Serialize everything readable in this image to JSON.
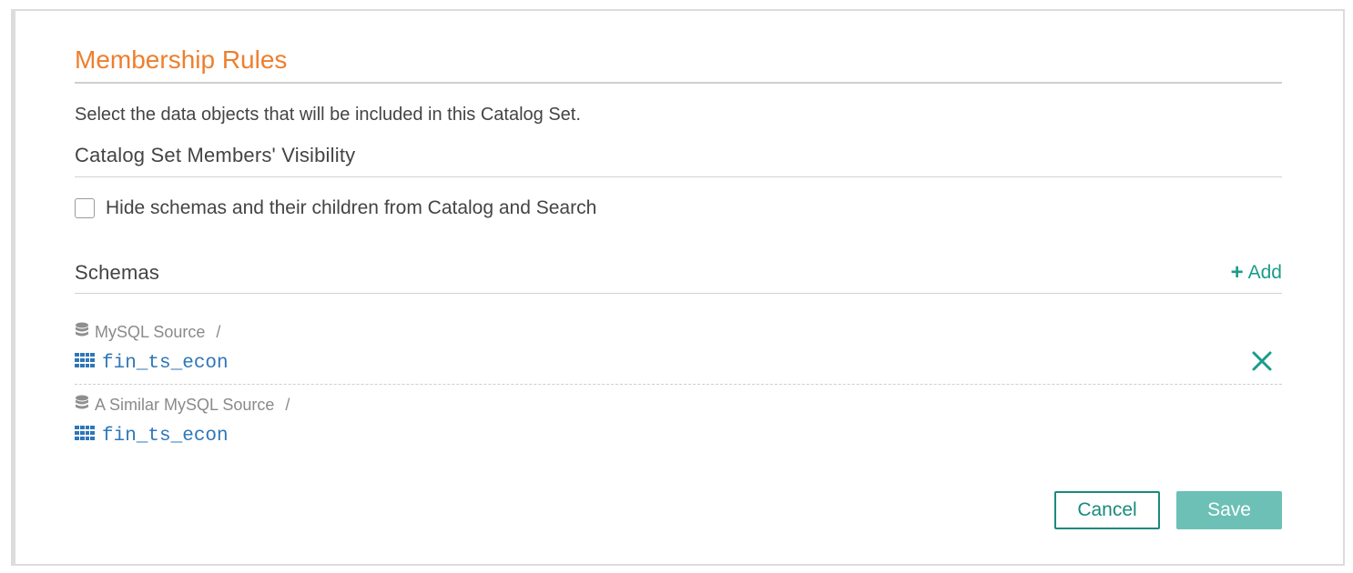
{
  "panel": {
    "title": "Membership Rules",
    "description": "Select the data objects that will be included in this Catalog Set."
  },
  "visibility": {
    "title": "Catalog Set Members' Visibility",
    "checkbox_label": "Hide schemas and their children from Catalog and Search",
    "checked": false
  },
  "schemas": {
    "title": "Schemas",
    "add_label": "Add",
    "items": [
      {
        "source": "MySQL Source",
        "separator": "/",
        "schema": "fin_ts_econ"
      },
      {
        "source": "A Similar MySQL Source",
        "separator": "/",
        "schema": "fin_ts_econ"
      }
    ]
  },
  "actions": {
    "cancel_label": "Cancel",
    "save_label": "Save"
  },
  "colors": {
    "accent_orange": "#ee7f2d",
    "teal": "#1a9c8a",
    "link_blue": "#2e77b8",
    "save_disabled": "#6cc0b6"
  }
}
